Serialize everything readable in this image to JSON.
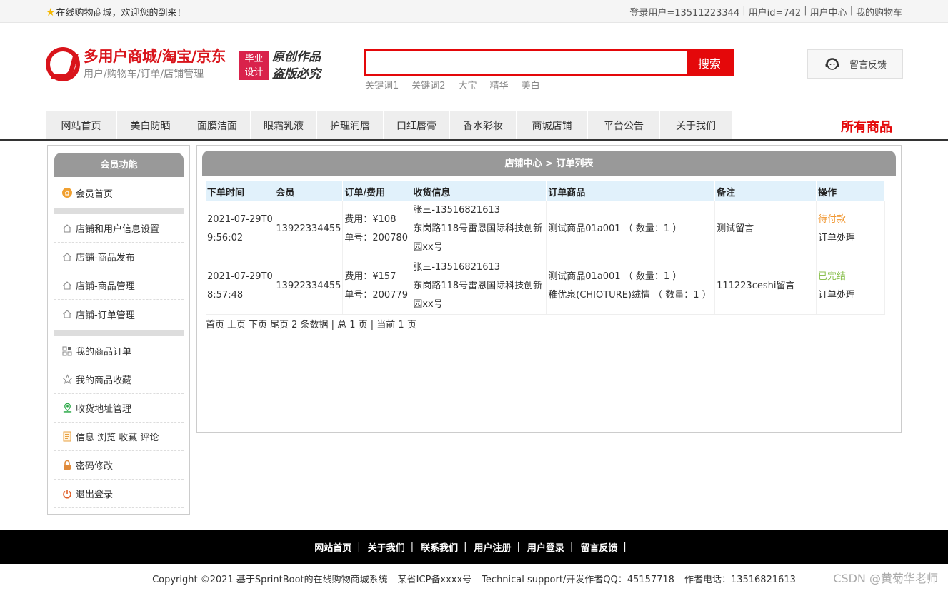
{
  "topbar": {
    "welcome": "在线购物商城，欢迎您的到来！",
    "login_user": "登录用户=13511223344",
    "user_id": "用户id=742",
    "user_center": "用户中心",
    "my_cart": "我的购物车",
    "sep": "|"
  },
  "header": {
    "logo_title": "多用户商城/淘宝/京东",
    "logo_subtitle": "用户/购物车/订单/店铺管理",
    "badge_line1": "毕业",
    "badge_line2": "设计",
    "slogan_line1": "原创作品",
    "slogan_line2": "盗版必究",
    "search_value": "",
    "search_button": "搜索",
    "hotwords": [
      "关键词1",
      "关键词2",
      "大宝",
      "精华",
      "美白"
    ],
    "feedback": "留言反馈"
  },
  "nav": {
    "items": [
      "网站首页",
      "美白防晒",
      "面膜洁面",
      "眼霜乳液",
      "护理润唇",
      "口红唇膏",
      "香水彩妆",
      "商城店铺",
      "平台公告",
      "关于我们"
    ],
    "all_goods": "所有商品"
  },
  "sidebar": {
    "title": "会员功能",
    "home": "会员首页",
    "shop_items": [
      "店铺和用户信息设置",
      "店铺-商品发布",
      "店铺-商品管理",
      "店铺-订单管理"
    ],
    "user_items": [
      "我的商品订单",
      "我的商品收藏",
      "收货地址管理",
      "信息 浏览 收藏 评论",
      "密码修改",
      "退出登录"
    ]
  },
  "main": {
    "title": "店铺中心 > 订单列表",
    "columns": [
      "下单时间",
      "会员",
      "订单/费用",
      "收货信息",
      "订单商品",
      "备注",
      "操作"
    ],
    "orders": [
      {
        "time": "2021-07-29T09:56:02",
        "member": "13922334455",
        "fee": "费用：¥108",
        "order_no": "单号：200780",
        "receiver": "张三-13516821613",
        "address": "东岗路118号雷恩国际科技创新园xx号",
        "goods": [
          "测试商品01a001 （ 数量：1 ）"
        ],
        "remark": "测试留言",
        "status": "待付款",
        "action": "订单处理"
      },
      {
        "time": "2021-07-29T08:57:48",
        "member": "13922334455",
        "fee": "费用：¥157",
        "order_no": "单号：200779",
        "receiver": "张三-13516821613",
        "address": "东岗路118号雷恩国际科技创新园xx号",
        "goods": [
          "测试商品01a001 （ 数量：1 ）",
          "稚优泉(CHIOTURE)绒情 （ 数量：1 ）"
        ],
        "remark": "111223ceshi留言",
        "status": "已完结",
        "action": "订单处理"
      }
    ],
    "pager": {
      "first": "首页",
      "prev": "上页",
      "next": "下页",
      "last": "尾页",
      "summary": "2 条数据 | 总 1 页 | 当前 1 页"
    }
  },
  "footer": {
    "links": [
      "网站首页",
      "关于我们",
      "联系我们",
      "用户注册",
      "用户登录",
      "留言反馈"
    ],
    "sep": "|",
    "copyright": "Copyright ©2021 基于SprintBoot的在线购物商城系统",
    "icp": "某省ICP备xxxx号",
    "support": "Technical support/开发作者QQ：45157718",
    "phone": "作者电话：13516821613",
    "watermark": "CSDN @黄菊华老师"
  },
  "colors": {
    "brand_red": "#e4080a",
    "logo_red": "#d9141b",
    "badge_red": "#d9224b",
    "panel_gray": "#999999",
    "table_head_blue": "#e1f1fb",
    "status_pending": "#f0962f",
    "status_done": "#8cc152"
  }
}
